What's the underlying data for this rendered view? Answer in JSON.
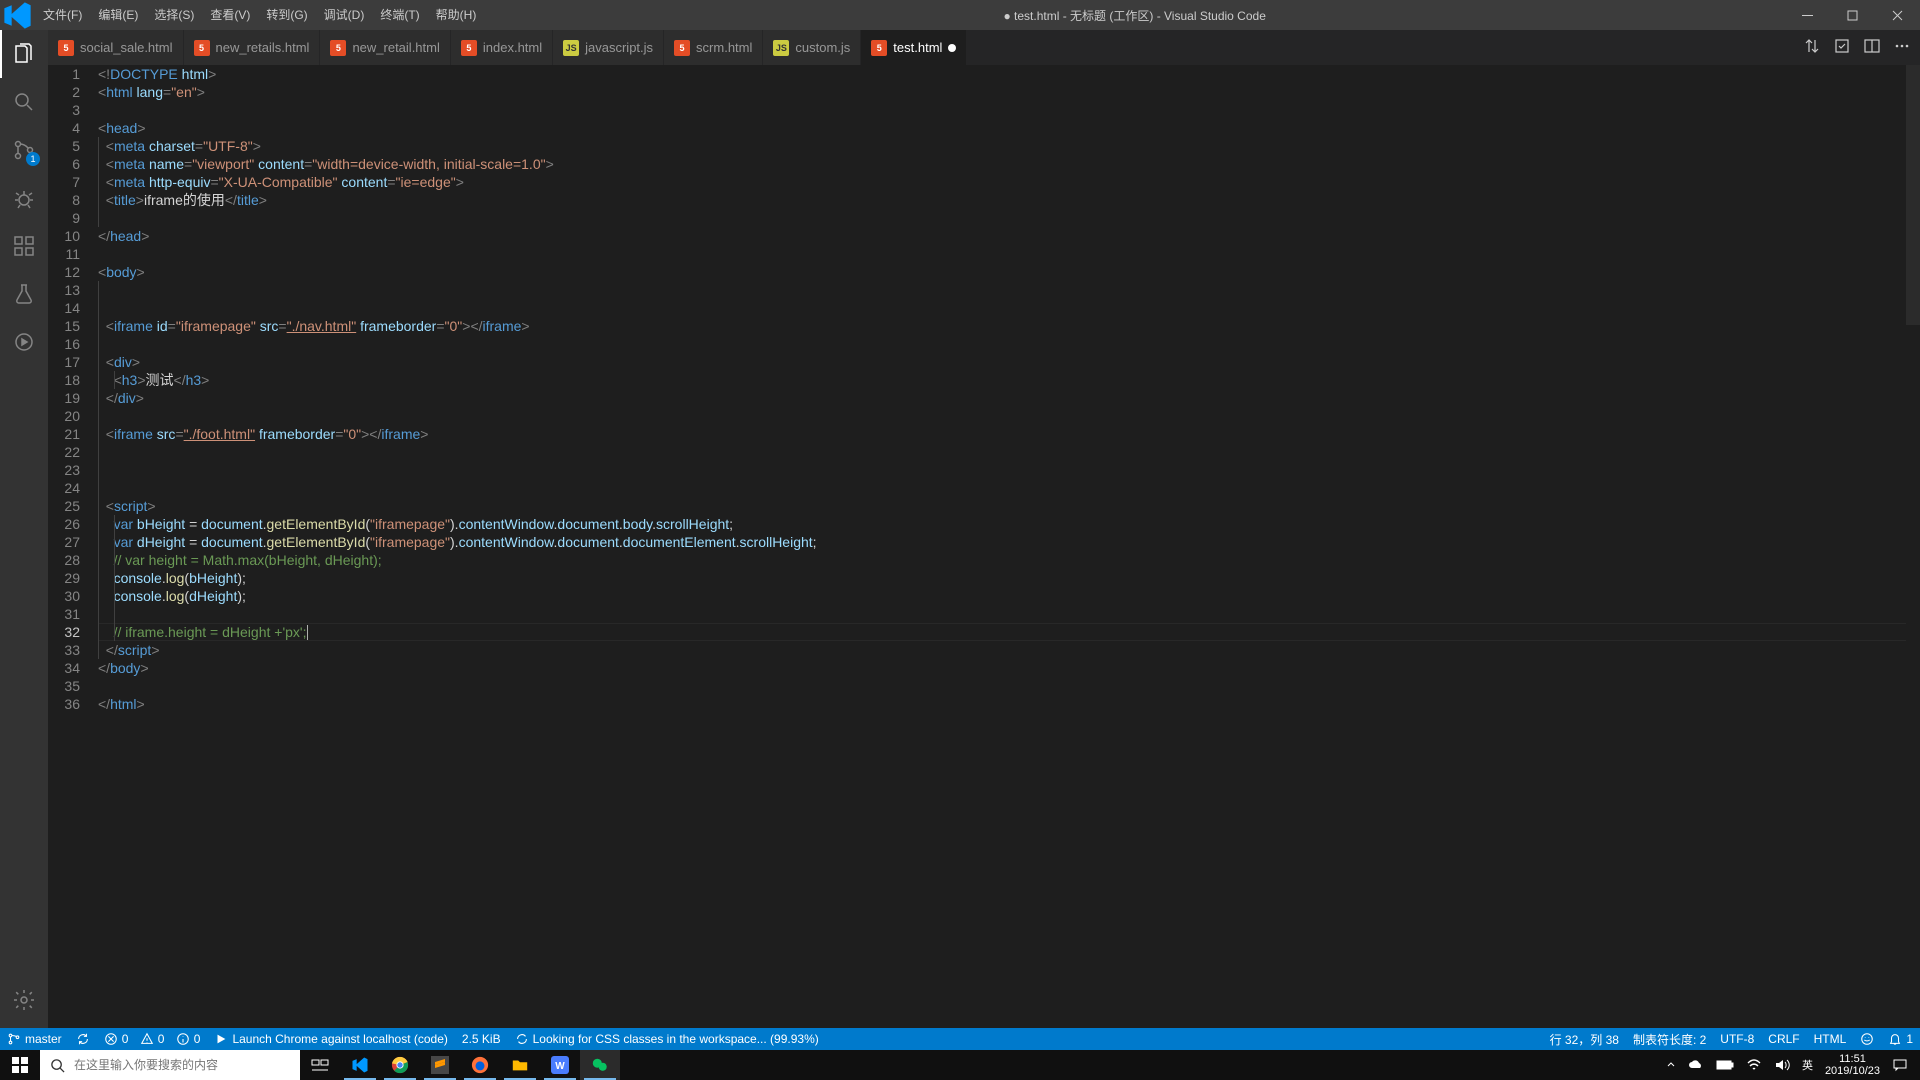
{
  "window": {
    "title": "● test.html - 无标题 (工作区) - Visual Studio Code"
  },
  "menu": [
    "文件(F)",
    "编辑(E)",
    "选择(S)",
    "查看(V)",
    "转到(G)",
    "调试(D)",
    "终端(T)",
    "帮助(H)"
  ],
  "activity": {
    "scm_badge": "1"
  },
  "tabs": [
    {
      "icon": "html",
      "label": "social_sale.html",
      "active": false,
      "dirty": false
    },
    {
      "icon": "html",
      "label": "new_retails.html",
      "active": false,
      "dirty": false
    },
    {
      "icon": "html",
      "label": "new_retail.html",
      "active": false,
      "dirty": false
    },
    {
      "icon": "html",
      "label": "index.html",
      "active": false,
      "dirty": false
    },
    {
      "icon": "js",
      "label": "javascript.js",
      "active": false,
      "dirty": false
    },
    {
      "icon": "html",
      "label": "scrm.html",
      "active": false,
      "dirty": false
    },
    {
      "icon": "js",
      "label": "custom.js",
      "active": false,
      "dirty": false
    },
    {
      "icon": "html",
      "label": "test.html",
      "active": true,
      "dirty": true
    }
  ],
  "icon_text": {
    "html": "5",
    "js": "JS"
  },
  "tabs_actions_tooltip": "更多操作",
  "code": {
    "total_lines": 36,
    "current_line": 32,
    "lines": [
      {
        "n": 1,
        "indent": 0,
        "html": "<span class='hl-punct'>&lt;!</span><span class='hl-tag'>DOCTYPE</span> <span class='hl-attr'>html</span><span class='hl-punct'>&gt;</span>"
      },
      {
        "n": 2,
        "indent": 0,
        "html": "<span class='hl-punct'>&lt;</span><span class='hl-tag'>html</span> <span class='hl-attr'>lang</span><span class='hl-punct'>=</span><span class='hl-str'>\"en\"</span><span class='hl-punct'>&gt;</span>"
      },
      {
        "n": 3,
        "indent": 0,
        "html": ""
      },
      {
        "n": 4,
        "indent": 0,
        "html": "<span class='hl-punct'>&lt;</span><span class='hl-tag'>head</span><span class='hl-punct'>&gt;</span>"
      },
      {
        "n": 5,
        "indent": 1,
        "html": "  <span class='hl-punct'>&lt;</span><span class='hl-tag'>meta</span> <span class='hl-attr'>charset</span><span class='hl-punct'>=</span><span class='hl-str'>\"UTF-8\"</span><span class='hl-punct'>&gt;</span>"
      },
      {
        "n": 6,
        "indent": 1,
        "html": "  <span class='hl-punct'>&lt;</span><span class='hl-tag'>meta</span> <span class='hl-attr'>name</span><span class='hl-punct'>=</span><span class='hl-str'>\"viewport\"</span> <span class='hl-attr'>content</span><span class='hl-punct'>=</span><span class='hl-str'>\"width=device-width, initial-scale=1.0\"</span><span class='hl-punct'>&gt;</span>"
      },
      {
        "n": 7,
        "indent": 1,
        "html": "  <span class='hl-punct'>&lt;</span><span class='hl-tag'>meta</span> <span class='hl-attr'>http-equiv</span><span class='hl-punct'>=</span><span class='hl-str'>\"X-UA-Compatible\"</span> <span class='hl-attr'>content</span><span class='hl-punct'>=</span><span class='hl-str'>\"ie=edge\"</span><span class='hl-punct'>&gt;</span>"
      },
      {
        "n": 8,
        "indent": 1,
        "html": "  <span class='hl-punct'>&lt;</span><span class='hl-tag'>title</span><span class='hl-punct'>&gt;</span><span class='hl-text'>iframe的使用</span><span class='hl-punct'>&lt;/</span><span class='hl-tag'>title</span><span class='hl-punct'>&gt;</span>"
      },
      {
        "n": 9,
        "indent": 1,
        "html": ""
      },
      {
        "n": 10,
        "indent": 0,
        "html": "<span class='hl-punct'>&lt;/</span><span class='hl-tag'>head</span><span class='hl-punct'>&gt;</span>"
      },
      {
        "n": 11,
        "indent": 0,
        "html": ""
      },
      {
        "n": 12,
        "indent": 0,
        "html": "<span class='hl-punct'>&lt;</span><span class='hl-tag'>body</span><span class='hl-punct'>&gt;</span>"
      },
      {
        "n": 13,
        "indent": 1,
        "html": ""
      },
      {
        "n": 14,
        "indent": 1,
        "html": ""
      },
      {
        "n": 15,
        "indent": 1,
        "html": "  <span class='hl-punct'>&lt;</span><span class='hl-tag'>iframe</span> <span class='hl-attr'>id</span><span class='hl-punct'>=</span><span class='hl-str'>\"iframepage\"</span> <span class='hl-attr'>src</span><span class='hl-punct'>=</span><span class='hl-str underline'>\"./nav.html\"</span> <span class='hl-attr'>frameborder</span><span class='hl-punct'>=</span><span class='hl-str'>\"0\"</span><span class='hl-punct'>&gt;&lt;/</span><span class='hl-tag'>iframe</span><span class='hl-punct'>&gt;</span>"
      },
      {
        "n": 16,
        "indent": 1,
        "html": ""
      },
      {
        "n": 17,
        "indent": 1,
        "html": "  <span class='hl-punct'>&lt;</span><span class='hl-tag'>div</span><span class='hl-punct'>&gt;</span>"
      },
      {
        "n": 18,
        "indent": 2,
        "html": "    <span class='hl-punct'>&lt;</span><span class='hl-tag'>h3</span><span class='hl-punct'>&gt;</span><span class='hl-text'>测试</span><span class='hl-punct'>&lt;/</span><span class='hl-tag'>h3</span><span class='hl-punct'>&gt;</span>"
      },
      {
        "n": 19,
        "indent": 1,
        "html": "  <span class='hl-punct'>&lt;/</span><span class='hl-tag'>div</span><span class='hl-punct'>&gt;</span>"
      },
      {
        "n": 20,
        "indent": 1,
        "html": ""
      },
      {
        "n": 21,
        "indent": 1,
        "html": "  <span class='hl-punct'>&lt;</span><span class='hl-tag'>iframe</span> <span class='hl-attr'>src</span><span class='hl-punct'>=</span><span class='hl-str underline'>\"./foot.html\"</span> <span class='hl-attr'>frameborder</span><span class='hl-punct'>=</span><span class='hl-str'>\"0\"</span><span class='hl-punct'>&gt;&lt;/</span><span class='hl-tag'>iframe</span><span class='hl-punct'>&gt;</span>"
      },
      {
        "n": 22,
        "indent": 1,
        "html": ""
      },
      {
        "n": 23,
        "indent": 1,
        "html": ""
      },
      {
        "n": 24,
        "indent": 1,
        "html": ""
      },
      {
        "n": 25,
        "indent": 1,
        "html": "  <span class='hl-punct'>&lt;</span><span class='hl-tag'>script</span><span class='hl-punct'>&gt;</span>"
      },
      {
        "n": 26,
        "indent": 2,
        "html": "    <span class='hl-kw'>var</span> <span class='hl-var'>bHeight</span> <span class='hl-text'>=</span> <span class='hl-var'>document</span><span class='hl-text'>.</span><span class='hl-func'>getElementById</span><span class='hl-text'>(</span><span class='hl-str'>\"iframepage\"</span><span class='hl-text'>).</span><span class='hl-var'>contentWindow</span><span class='hl-text'>.</span><span class='hl-var'>document</span><span class='hl-text'>.</span><span class='hl-var'>body</span><span class='hl-text'>.</span><span class='hl-var'>scrollHeight</span><span class='hl-text'>;</span>"
      },
      {
        "n": 27,
        "indent": 2,
        "html": "    <span class='hl-kw'>var</span> <span class='hl-var'>dHeight</span> <span class='hl-text'>=</span> <span class='hl-var'>document</span><span class='hl-text'>.</span><span class='hl-func'>getElementById</span><span class='hl-text'>(</span><span class='hl-str'>\"iframepage\"</span><span class='hl-text'>).</span><span class='hl-var'>contentWindow</span><span class='hl-text'>.</span><span class='hl-var'>document</span><span class='hl-text'>.</span><span class='hl-var'>documentElement</span><span class='hl-text'>.</span><span class='hl-var'>scrollHeight</span><span class='hl-text'>;</span>"
      },
      {
        "n": 28,
        "indent": 2,
        "html": "    <span class='hl-comment'>// var height = Math.max(bHeight, dHeight);</span>"
      },
      {
        "n": 29,
        "indent": 2,
        "html": "    <span class='hl-var'>console</span><span class='hl-text'>.</span><span class='hl-func'>log</span><span class='hl-text'>(</span><span class='hl-var'>bHeight</span><span class='hl-text'>);</span>"
      },
      {
        "n": 30,
        "indent": 2,
        "html": "    <span class='hl-var'>console</span><span class='hl-text'>.</span><span class='hl-func'>log</span><span class='hl-text'>(</span><span class='hl-var'>dHeight</span><span class='hl-text'>);</span>"
      },
      {
        "n": 31,
        "indent": 2,
        "html": ""
      },
      {
        "n": 32,
        "indent": 2,
        "html": "    <span class='hl-comment'>// iframe.height = dHeight +'px';</span><span class='caret'></span>",
        "current": true
      },
      {
        "n": 33,
        "indent": 1,
        "html": "  <span class='hl-punct'>&lt;/</span><span class='hl-tag'>script</span><span class='hl-punct'>&gt;</span>"
      },
      {
        "n": 34,
        "indent": 0,
        "html": "<span class='hl-punct'>&lt;/</span><span class='hl-tag'>body</span><span class='hl-punct'>&gt;</span>"
      },
      {
        "n": 35,
        "indent": 0,
        "html": ""
      },
      {
        "n": 36,
        "indent": 0,
        "html": "<span class='hl-punct'>&lt;/</span><span class='hl-tag'>html</span><span class='hl-punct'>&gt;</span>"
      }
    ]
  },
  "status": {
    "branch": "master",
    "sync": "",
    "errors": "0",
    "warnings": "0",
    "info": "0",
    "debug": "Launch Chrome against localhost (code)",
    "size": "2.5 KiB",
    "css": "Looking for CSS classes in the workspace... (99.93%)",
    "ln_col": "行 32，列 38",
    "tab": "制表符长度: 2",
    "enc": "UTF-8",
    "eol": "CRLF",
    "lang": "HTML",
    "feedback": "",
    "bell": "1"
  },
  "taskbar": {
    "search_placeholder": "在这里输入你要搜索的内容",
    "ime": "英",
    "time": "11:51",
    "date": "2019/10/23"
  }
}
